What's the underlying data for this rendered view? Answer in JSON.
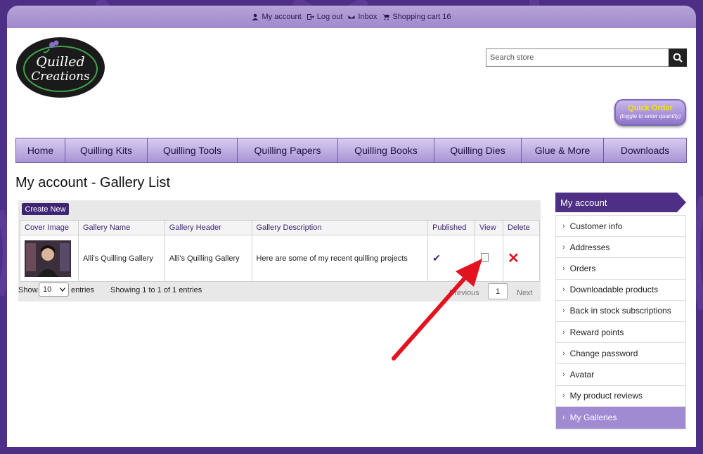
{
  "top_links": [
    {
      "label": "My account",
      "icon": "user-icon"
    },
    {
      "label": "Log out",
      "icon": "logout-icon"
    },
    {
      "label": "Inbox",
      "icon": "envelope-icon"
    },
    {
      "label": "Shopping cart 16",
      "icon": "cart-icon"
    }
  ],
  "logo": {
    "text_line1": "Quilled",
    "text_line2": "Creations"
  },
  "search": {
    "placeholder": "Search store"
  },
  "quick_order": {
    "label": "Quick Order",
    "sub": "(toggle to enter quantity)"
  },
  "nav": [
    "Home",
    "Quilling Kits",
    "Quilling Tools",
    "Quilling Papers",
    "Quilling Books",
    "Quilling Dies",
    "Glue & More",
    "Downloads"
  ],
  "page_title": "My account - Gallery List",
  "gallery": {
    "create_label": "Create New",
    "columns": [
      "Cover Image",
      "Gallery Name",
      "Gallery Header",
      "Gallery Description",
      "Published",
      "View",
      "Delete"
    ],
    "rows": [
      {
        "name": "Alli's Quilling Gallery",
        "header": "Alli's Quilling Gallery",
        "description": "Here are some of my recent quilling projects",
        "published": "✔",
        "delete": "✕"
      }
    ],
    "show_label": "Show",
    "show_value": "10",
    "entries_label": "entries",
    "showing": "Showing 1 to 1 of 1 entries",
    "prev": "Previous",
    "page": "1",
    "next": "Next"
  },
  "sidebar": {
    "title": "My account",
    "items": [
      "Customer info",
      "Addresses",
      "Orders",
      "Downloadable products",
      "Back in stock subscriptions",
      "Reward points",
      "Change password",
      "Avatar",
      "My product reviews",
      "My Galleries"
    ],
    "active": "My Galleries"
  },
  "colors": {
    "brand_purple": "#4e2f86",
    "accent_lavender": "#a08ad2",
    "arrow_red": "#e2131f"
  }
}
